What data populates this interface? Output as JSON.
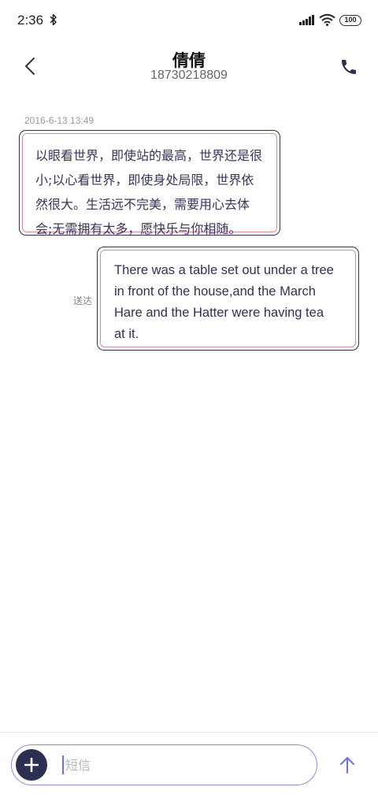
{
  "status_bar": {
    "time": "2:36",
    "battery": "100",
    "icons": [
      "bluetooth-icon",
      "signal-icon",
      "wifi-icon",
      "battery-icon"
    ]
  },
  "header": {
    "contact_name": "倩倩",
    "contact_number": "18730218809",
    "icons": [
      "back-chevron-icon",
      "phone-icon"
    ]
  },
  "conversation": {
    "timestamp": "2016-6-13 13:49",
    "messages": [
      {
        "direction": "incoming",
        "lines": [
          "以眼看世界，即使站的最高，世界还是很",
          "小;以心看世界，即使身处局限，世界依",
          "然很大。生活远不完美，需要用心去体",
          "会;无需拥有太多，愿快乐与你相随。"
        ]
      },
      {
        "direction": "outgoing",
        "status": "送达",
        "lines": [
          "There was a table set out under a tree",
          "in front of the house,and the March",
          "Hare and the Hatter were having tea",
          "at it."
        ]
      }
    ]
  },
  "composer": {
    "placeholder": "短信",
    "icons": [
      "plus-icon",
      "send-arrow-icon"
    ]
  },
  "colors": {
    "accent": "#6a72e6",
    "bubble_border": "#2f3150",
    "bubble_inner_border": "#d98aa0",
    "dark": "#2c2e52"
  }
}
